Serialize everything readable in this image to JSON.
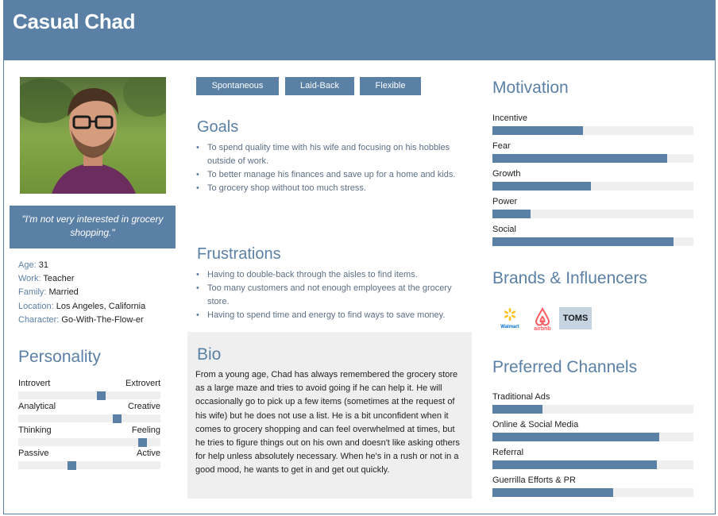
{
  "persona": {
    "name": "Casual Chad",
    "quote": "\"I'm not very interested in grocery shopping.\"",
    "info": [
      {
        "key": "Age:",
        "value": "31"
      },
      {
        "key": "Work:",
        "value": "Teacher"
      },
      {
        "key": "Family:",
        "value": "Married"
      },
      {
        "key": "Location:",
        "value": "Los Angeles, California"
      },
      {
        "key": "Character:",
        "value": "Go-With-The-Flow-er"
      }
    ]
  },
  "tags": [
    "Spontaneous",
    "Laid-Back",
    "Flexible"
  ],
  "personality": {
    "title": "Personality",
    "rows": [
      {
        "left": "Introvert",
        "right": "Extrovert",
        "level": 0.59
      },
      {
        "left": "Analytical",
        "right": "Creative",
        "level": 0.71
      },
      {
        "left": "Thinking",
        "right": "Feeling",
        "level": 0.9
      },
      {
        "left": "Passive",
        "right": "Active",
        "level": 0.37
      }
    ]
  },
  "goals": {
    "title": "Goals",
    "items": [
      "To spend quality time with his wife and focusing on his hobbles outside of work.",
      "To better manage his finances and save up for a home and kids.",
      "To grocery shop without too much stress."
    ]
  },
  "frustrations": {
    "title": "Frustrations",
    "items": [
      "Having to double-back through the aisles to find items.",
      "Too many customers and not enough employees at the grocery store.",
      "Having to spend time and energy to find ways to save money."
    ]
  },
  "bio": {
    "title": "Bio",
    "text": "From a young age, Chad has always remembered the grocery store as a large maze and tries to avoid going if he can help it. He will occasionally go to pick up a few items (sometimes at the request of his wife) but he does not use a list. He is a bit unconfident when it comes to grocery shopping and can feel overwhelmed at times, but he tries to figure things out on his own and doesn't like asking others for help unless absolutely necessary. When he's in a rush or not in a good mood, he wants to get in and get out quickly."
  },
  "motivation": {
    "title": "Motivation",
    "items": [
      {
        "label": "Incentive",
        "level": 0.45
      },
      {
        "label": "Fear",
        "level": 0.87
      },
      {
        "label": "Growth",
        "level": 0.49
      },
      {
        "label": "Power",
        "level": 0.19
      },
      {
        "label": "Social",
        "level": 0.9
      }
    ]
  },
  "brands": {
    "title": "Brands & Influencers",
    "logos": [
      {
        "name": "walmart",
        "text": "Walmart",
        "color": "#0071ce",
        "accent": "#ffc220"
      },
      {
        "name": "airbnb",
        "text": "airbnb",
        "color": "#ff5a5f"
      },
      {
        "name": "toms",
        "text": "TOMS",
        "color": "#1a1a1a",
        "background": "#c6d3e1"
      }
    ]
  },
  "channels": {
    "title": "Preferred Channels",
    "items": [
      {
        "label": "Traditional Ads",
        "level": 0.25
      },
      {
        "label": "Online & Social Media",
        "level": 0.83
      },
      {
        "label": "Referral",
        "level": 0.82
      },
      {
        "label": "Guerrilla Efforts & PR",
        "level": 0.6
      }
    ]
  },
  "colors": {
    "accent": "#5b80a6",
    "track": "#efefef",
    "bio_background": "#efefef"
  }
}
